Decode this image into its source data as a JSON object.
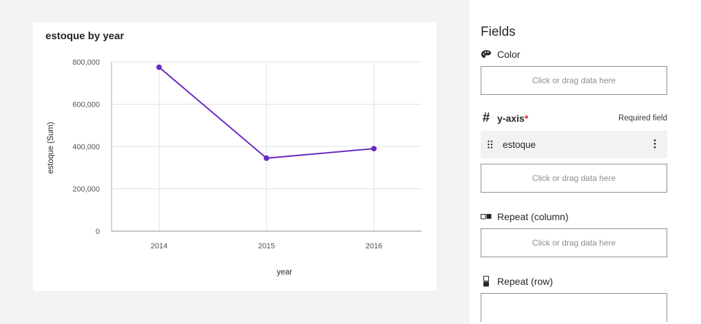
{
  "chart": {
    "title": "estoque by year"
  },
  "chart_data": {
    "type": "line",
    "title": "estoque by year",
    "xlabel": "year",
    "ylabel": "estoque (Sum)",
    "categories": [
      "2014",
      "2015",
      "2016"
    ],
    "values": [
      775000,
      345000,
      390000
    ],
    "ylim": [
      0,
      800000
    ],
    "yticks": [
      0,
      200000,
      400000,
      600000,
      800000
    ],
    "ytick_labels": [
      "0",
      "200,000",
      "400,000",
      "600,000",
      "800,000"
    ],
    "grid": true,
    "color": "#6929c4"
  },
  "panel": {
    "title": "Fields",
    "color": {
      "label": "Color",
      "icon": "palette-icon",
      "dropzone": "Click or drag data here"
    },
    "y_axis": {
      "label": "y-axis",
      "required_star": "*",
      "required_note": "Required field",
      "icon": "hash-icon",
      "hash_glyph": "#",
      "field": "estoque",
      "dropzone": "Click or drag data here"
    },
    "repeat_column": {
      "label": "Repeat (column)",
      "icon": "repeat-column-icon",
      "dropzone": "Click or drag data here"
    },
    "repeat_row": {
      "label": "Repeat (row)",
      "icon": "repeat-row-icon"
    }
  },
  "colors": {
    "accent": "#6929c4",
    "required": "#da1e28"
  }
}
